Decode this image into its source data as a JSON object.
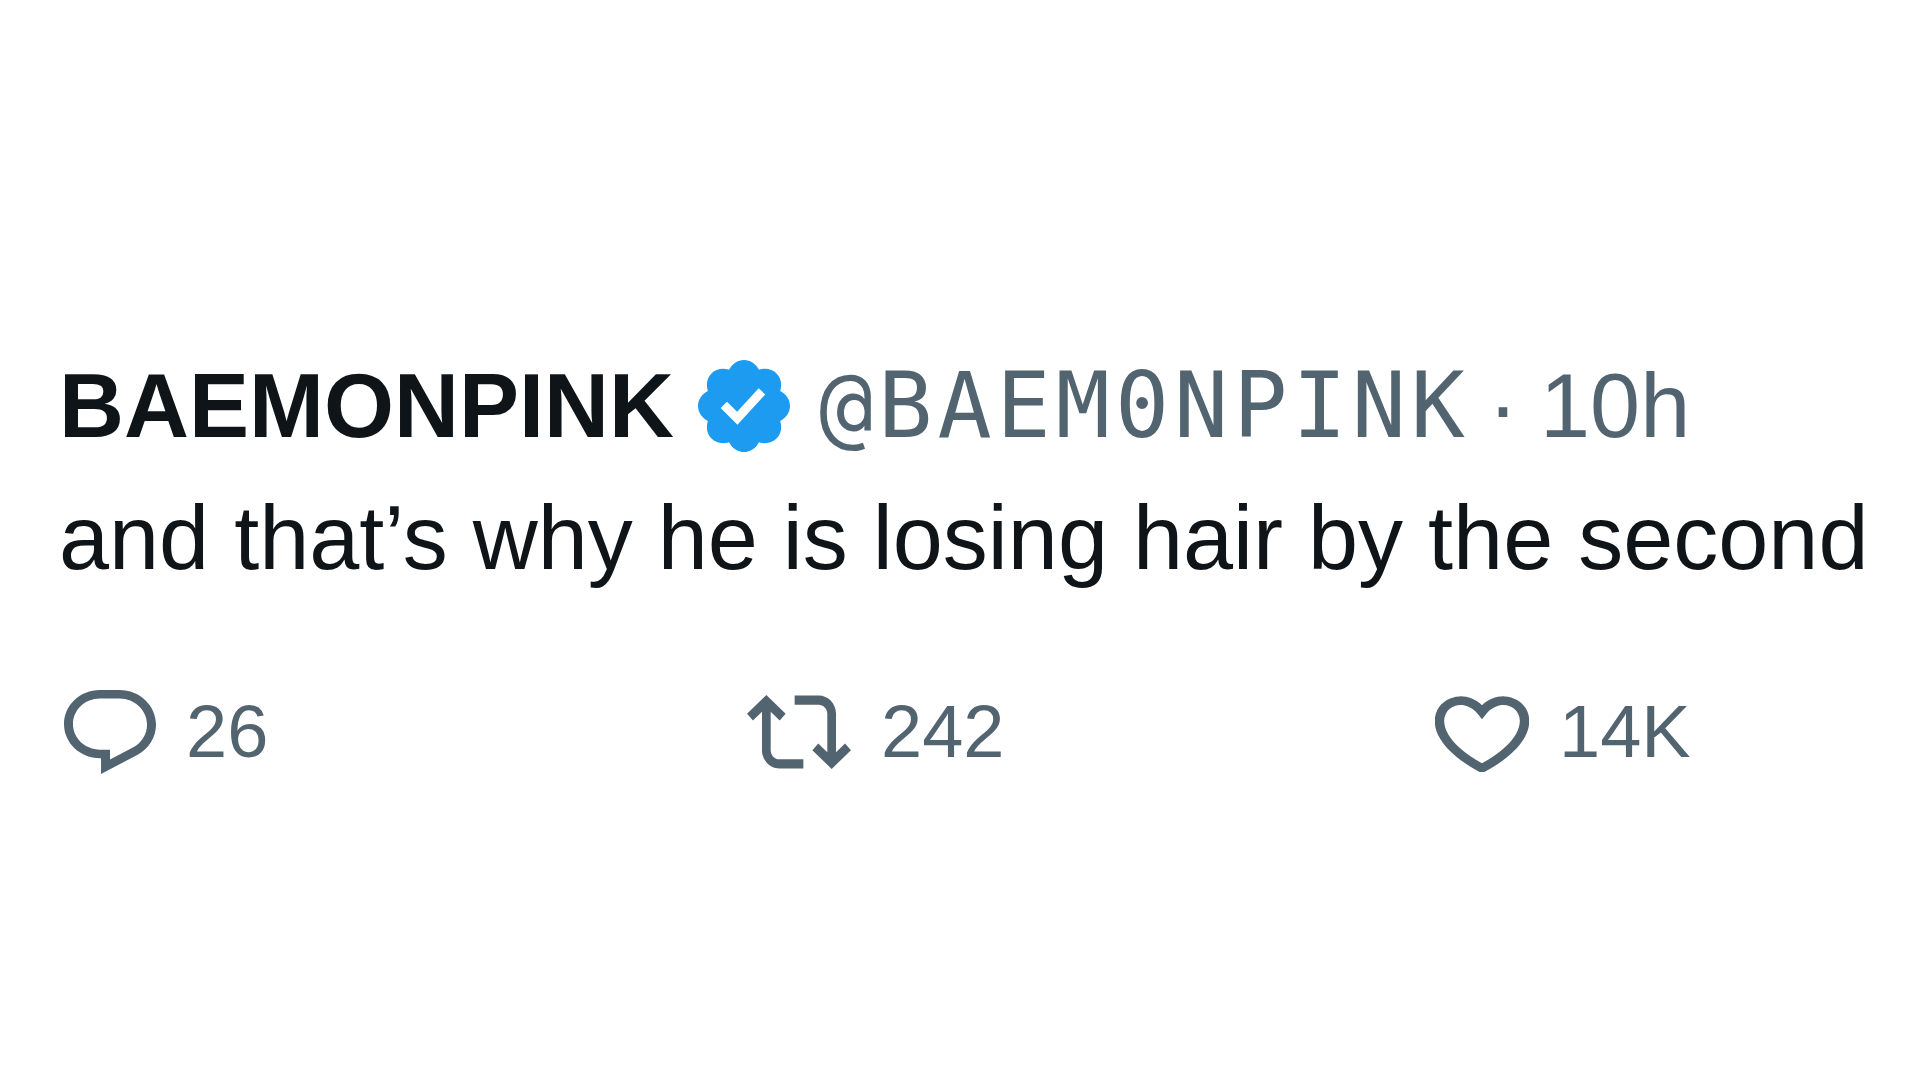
{
  "tweet": {
    "author": {
      "name": "BAEMONPINK",
      "verified": true,
      "handle": "@BAEM0NPINK",
      "separator": "·",
      "time": "10h"
    },
    "text": "and that’s why he is losing hair by the second",
    "actions": [
      {
        "kind": "reply",
        "count": "26"
      },
      {
        "kind": "retweet",
        "count": "242"
      },
      {
        "kind": "like",
        "count": "14K"
      }
    ]
  }
}
